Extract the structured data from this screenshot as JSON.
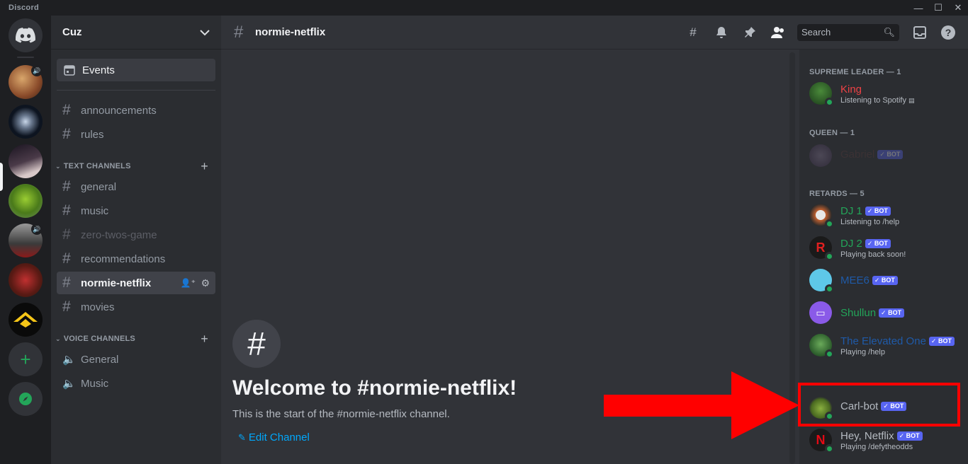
{
  "app": {
    "brand": "Discord"
  },
  "window": {
    "minimize": "—",
    "maximize": "☐",
    "close": "✕"
  },
  "server": {
    "name": "Cuz"
  },
  "sidebar": {
    "events": "Events",
    "top_channels": [
      "announcements",
      "rules"
    ],
    "text_category": "TEXT CHANNELS",
    "text_channels": [
      "general",
      "music",
      "zero-twos-game",
      "recommendations",
      "normie-netflix",
      "movies"
    ],
    "voice_category": "VOICE CHANNELS",
    "voice_channels": [
      "General",
      "Music"
    ]
  },
  "header": {
    "channel": "normie-netflix",
    "search_placeholder": "Search"
  },
  "welcome": {
    "title": "Welcome to #normie-netflix!",
    "subtitle": "This is the start of the #normie-netflix channel.",
    "edit": "Edit Channel"
  },
  "members": {
    "bot_tag": "BOT",
    "groups": [
      {
        "label": "SUPREME LEADER — 1"
      },
      {
        "label": "QUEEN — 1"
      },
      {
        "label": "RETARDS — 5"
      }
    ],
    "list": [
      {
        "name": "King",
        "activity": "Listening to Spotify",
        "color": "#ed4245"
      },
      {
        "name": "Gabriel",
        "activity": "",
        "color": "#5a3a3a"
      },
      {
        "name": "DJ 1",
        "activity": "Listening to /help",
        "color": "#23a559"
      },
      {
        "name": "DJ 2",
        "activity": "Playing back soon!",
        "color": "#23a559"
      },
      {
        "name": "MEE6",
        "activity": "",
        "color": "#1f5aa8"
      },
      {
        "name": "Shullun",
        "activity": "",
        "color": "#23a559"
      },
      {
        "name": "The Elevated One",
        "activity": "Playing /help",
        "color": "#1f5aa8"
      },
      {
        "name": "Carl-bot",
        "activity": "",
        "color": "#b5bac1"
      },
      {
        "name": "Hey, Netflix",
        "activity": "Playing /defytheodds",
        "color": "#b5bac1"
      }
    ]
  },
  "colors": {
    "accent": "#5865f2",
    "online": "#23a559",
    "highlight": "#ff0000"
  }
}
